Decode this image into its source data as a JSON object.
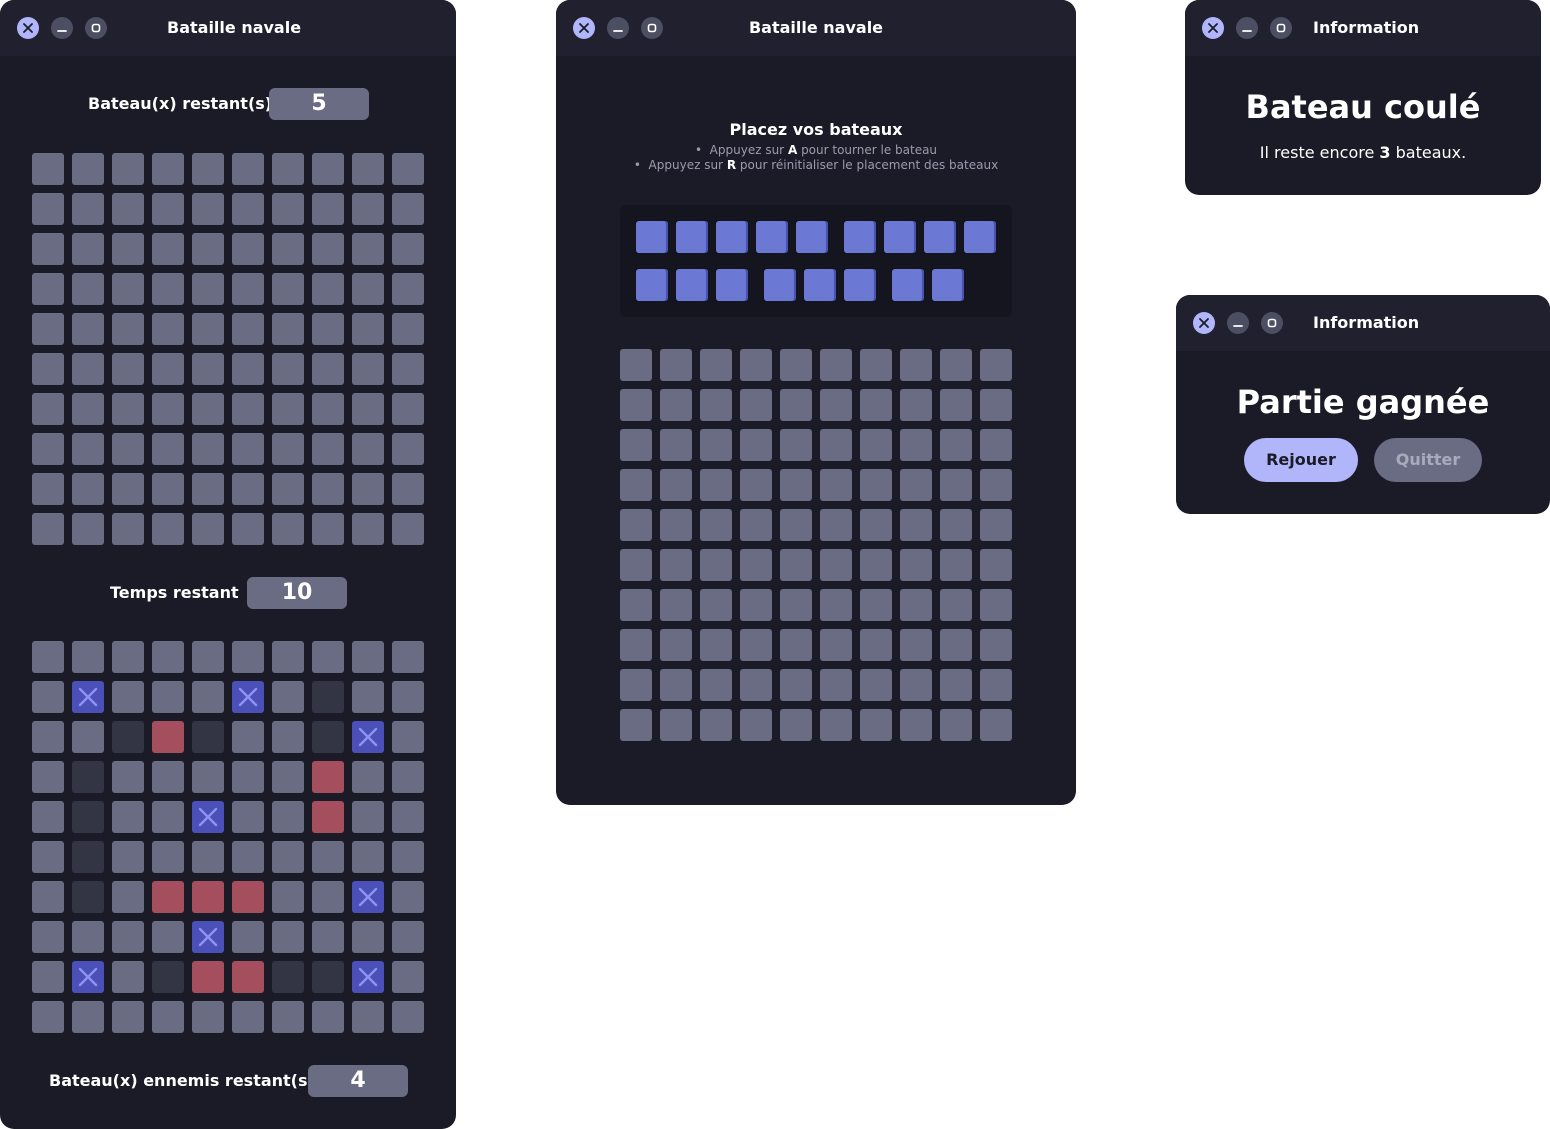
{
  "game_window": {
    "title": "Bataille navale",
    "boats_left_label": "Bateau(x) restant(s)",
    "boats_left_value": "5",
    "time_left_label": "Temps restant",
    "time_left_value": "10",
    "enemy_boats_label": "Bateau(x) ennemis restant(s)",
    "enemy_boats_value": "4",
    "player_grid_size": [
      10,
      10
    ],
    "enemy_grid": [
      [
        "",
        "",
        "",
        "",
        "",
        "",
        "",
        "",
        "",
        ""
      ],
      [
        "",
        "x",
        "",
        "",
        "",
        "x",
        "",
        "miss",
        "",
        ""
      ],
      [
        "",
        "",
        "miss",
        "hit",
        "miss",
        "",
        "",
        "miss",
        "x",
        ""
      ],
      [
        "",
        "miss",
        "",
        "",
        "",
        "",
        "",
        "hit",
        "",
        ""
      ],
      [
        "",
        "miss",
        "",
        "",
        "x",
        "",
        "",
        "hit",
        "",
        ""
      ],
      [
        "",
        "miss",
        "",
        "",
        "",
        "",
        "",
        "",
        "",
        ""
      ],
      [
        "",
        "miss",
        "",
        "hit",
        "hit",
        "hit",
        "",
        "",
        "x",
        ""
      ],
      [
        "",
        "",
        "",
        "",
        "x",
        "",
        "",
        "",
        "",
        ""
      ],
      [
        "",
        "x",
        "",
        "miss",
        "hit",
        "hit",
        "miss",
        "miss",
        "x",
        ""
      ],
      [
        "",
        "",
        "",
        "",
        "",
        "",
        "",
        "",
        "",
        ""
      ]
    ]
  },
  "placement_window": {
    "title": "Bataille navale",
    "heading": "Placez vos bateaux",
    "instruction_1_prefix": "Appuyez sur",
    "instruction_1_key": "A",
    "instruction_1_suffix": "pour tourner le bateau",
    "instruction_2_prefix": "Appuyez sur",
    "instruction_2_key": "R",
    "instruction_2_suffix": "pour réinitialiser le placement des bateaux",
    "ships": [
      5,
      4,
      3,
      3,
      2
    ],
    "grid_size": [
      10,
      10
    ]
  },
  "info_sunk": {
    "title": "Information",
    "heading": "Bateau coulé",
    "text_prefix": "Il reste encore",
    "count": "3",
    "text_suffix": "bateaux."
  },
  "info_win": {
    "title": "Information",
    "heading": "Partie gagnée",
    "replay_label": "Rejouer",
    "quit_label": "Quitter"
  },
  "colors": {
    "window_bg": "#1b1b27",
    "cell": "#6a6c84",
    "hit": "#a54e5d",
    "miss": "#343544",
    "shot_mark": "#4b50b8",
    "ship": "#6b78d4",
    "accent": "#b1b6fb"
  },
  "icons": {
    "close": "close-icon",
    "minimize": "minimize-icon",
    "maximize": "maximize-icon",
    "shot": "cross-mark-icon"
  }
}
